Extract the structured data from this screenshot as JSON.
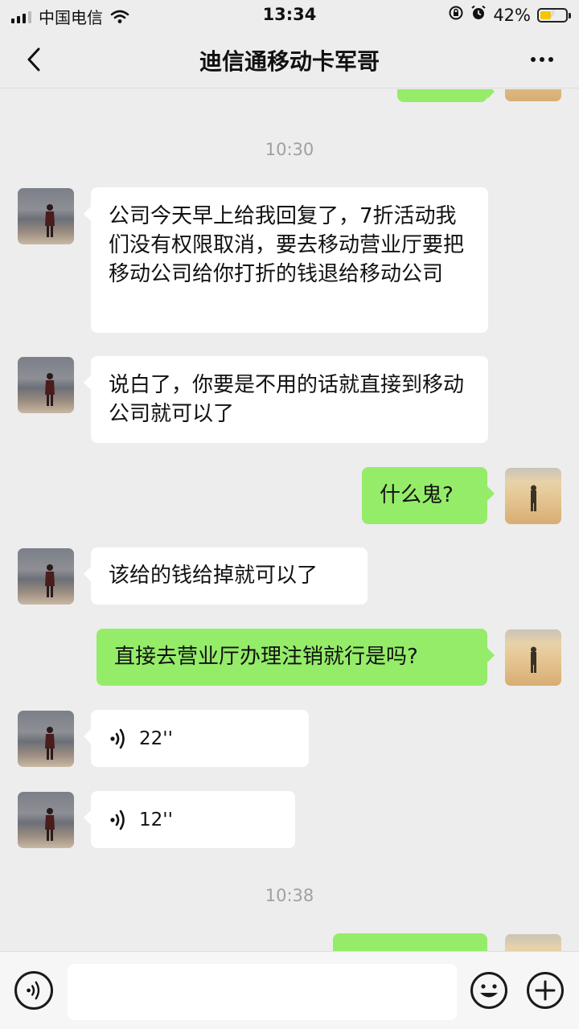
{
  "status_bar": {
    "carrier": "中国电信",
    "time": "13:34",
    "battery_text": "42%",
    "battery_level": 0.42
  },
  "navbar": {
    "title": "迪信通移动卡军哥"
  },
  "messages": [
    {
      "kind": "time",
      "text": "10:30"
    },
    {
      "kind": "text",
      "from": "contact",
      "text": "公司今天早上给我回复了，7折活动我们没有权限取消，要去移动营业厅要把移动公司给你打折的钱退给移动公司"
    },
    {
      "kind": "text",
      "from": "contact",
      "text": "说白了，你要是不用的话就直接到移动公司就可以了"
    },
    {
      "kind": "text",
      "from": "me",
      "text": "什么鬼?"
    },
    {
      "kind": "text",
      "from": "contact",
      "text": "该给的钱给掉就可以了"
    },
    {
      "kind": "text",
      "from": "me",
      "text": "直接去营业厅办理注销就行是吗?"
    },
    {
      "kind": "voice",
      "from": "contact",
      "text": "22''"
    },
    {
      "kind": "voice",
      "from": "contact",
      "text": "12''"
    },
    {
      "kind": "time",
      "text": "10:38"
    }
  ],
  "input_bar": {
    "text_value": ""
  },
  "colors": {
    "background": "#ededed",
    "outgoing_bubble": "#95ec69",
    "incoming_bubble": "#ffffff",
    "battery_fill": "#f7c600"
  }
}
